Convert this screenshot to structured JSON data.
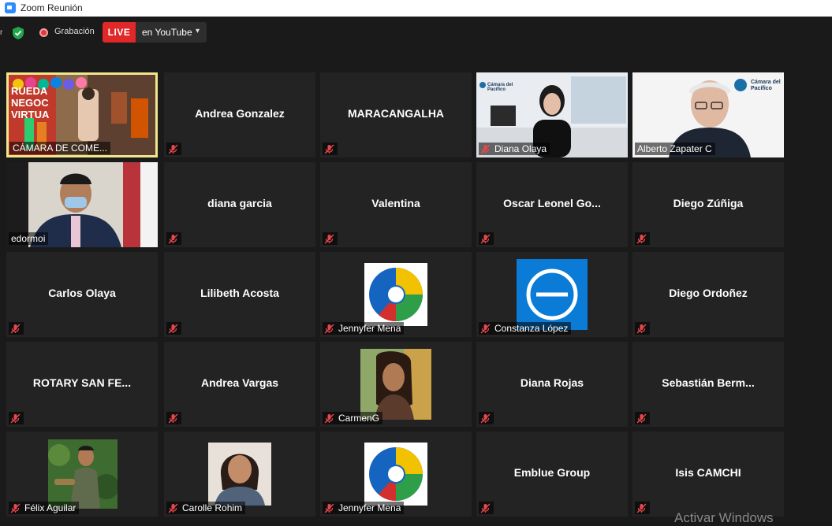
{
  "window": {
    "title": "Zoom Reunión"
  },
  "topbar": {
    "edge_letter": "r",
    "recording_label": "Grabación",
    "live_badge": "LIVE",
    "live_target": "en YouTube",
    "caret": "▾"
  },
  "colors": {
    "live_red": "#e02828",
    "active_speaker_border": "#f0e68c",
    "shield_green": "#1fa84a"
  },
  "icons": {
    "mic": "mic-muted-icon",
    "shield": "shield-check-icon"
  },
  "tiles": [
    {
      "label": "CÁMARA DE COME..."
    },
    {
      "label": "Andrea Gonzalez"
    },
    {
      "label": "MARACANGALHA"
    },
    {
      "label": "Diana Olaya"
    },
    {
      "label": "Alberto Zapater C"
    },
    {
      "label": "edormoi"
    },
    {
      "label": "diana garcia"
    },
    {
      "label": "Valentina"
    },
    {
      "label": "Oscar  Leonel  Go..."
    },
    {
      "label": "Diego Zúñiga"
    },
    {
      "label": "Carlos Olaya"
    },
    {
      "label": "Lilibeth Acosta"
    },
    {
      "label": "Jennyfer Mena"
    },
    {
      "label": "Constanza López"
    },
    {
      "label": "Diego Ordoñez"
    },
    {
      "label": "ROTARY SAN FE..."
    },
    {
      "label": "Andrea Vargas"
    },
    {
      "label": "CarmenG"
    },
    {
      "label": "Diana Rojas"
    },
    {
      "label": "Sebastián  Berm..."
    },
    {
      "label": "Félix Aguilar"
    },
    {
      "label": "Carolle Rohim"
    },
    {
      "label": "Jennyfer Mena"
    },
    {
      "label": "Emblue Group"
    },
    {
      "label": "Isis CAMCHI"
    }
  ],
  "presentation": {
    "line1": "RUEDA",
    "line2": "NEGOC",
    "line3": "VIRTUA"
  },
  "logo_text": {
    "camara": "Cámara del",
    "pacifico": "Pacífico"
  },
  "os_watermark": "Activar Windows"
}
